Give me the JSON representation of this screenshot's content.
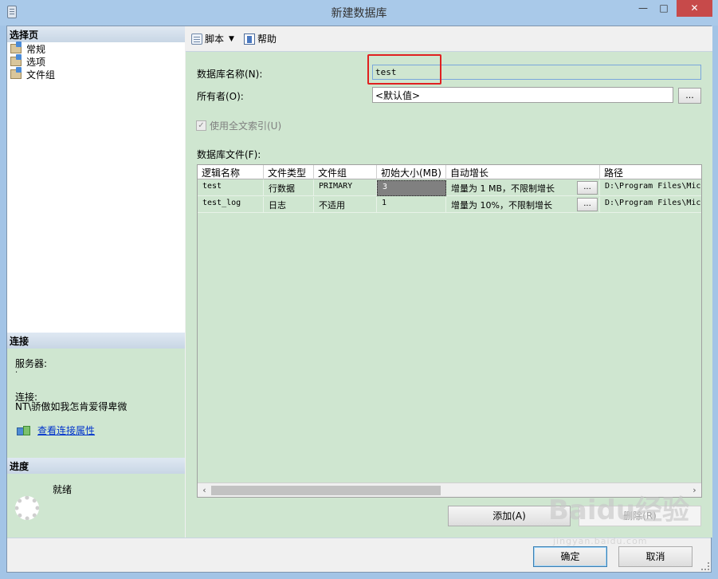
{
  "window": {
    "title": "新建数据库",
    "min_glyph": "—",
    "max_glyph": "□",
    "close_glyph": "✕"
  },
  "left_panel": {
    "select_page_title": "选择页",
    "pages": [
      {
        "label": "常规"
      },
      {
        "label": "选项"
      },
      {
        "label": "文件组"
      }
    ],
    "connection": {
      "title": "连接",
      "server_label": "服务器:",
      "server_value": ".",
      "connection_label": "连接:",
      "connection_value": "NT\\骄傲如我怎肯爱得卑微",
      "view_properties_link": "查看连接属性"
    },
    "progress": {
      "title": "进度",
      "status": "就绪"
    }
  },
  "toolbar": {
    "script_label": "脚本",
    "help_label": "帮助"
  },
  "form": {
    "db_name_label": "数据库名称(N):",
    "db_name_value": "test",
    "owner_label": "所有者(O):",
    "owner_value": "<默认值>",
    "browse_button": "...",
    "fulltext_label": "使用全文索引(U)",
    "fulltext_checked": true,
    "db_files_label": "数据库文件(F):"
  },
  "files_grid": {
    "columns": [
      "逻辑名称",
      "文件类型",
      "文件组",
      "初始大小(MB)",
      "自动增长",
      "路径"
    ],
    "rows": [
      {
        "logical_name": "test",
        "file_type": "行数据",
        "filegroup": "PRIMARY",
        "initial_size": "3",
        "autogrowth": "增量为 1 MB，不限制增长",
        "path": "D:\\Program Files\\Mic"
      },
      {
        "logical_name": "test_log",
        "file_type": "日志",
        "filegroup": "不适用",
        "initial_size": "1",
        "autogrowth": "增量为 10%，不限制增长",
        "path": "D:\\Program Files\\Mic"
      }
    ],
    "ellipsis": "...",
    "scroll_left": "‹",
    "scroll_right": "›"
  },
  "actions": {
    "add_label": "添加(A)",
    "remove_label": "删除(R)",
    "ok_label": "确定",
    "cancel_label": "取消"
  },
  "watermark": {
    "brand": "Baidu经验",
    "url": "jingyan.baidu.com"
  },
  "colors": {
    "panel_green": "#cfe6d0",
    "highlight_red": "#e02020",
    "title_blue": "#a9c9e9",
    "close_red": "#c74a4a"
  }
}
